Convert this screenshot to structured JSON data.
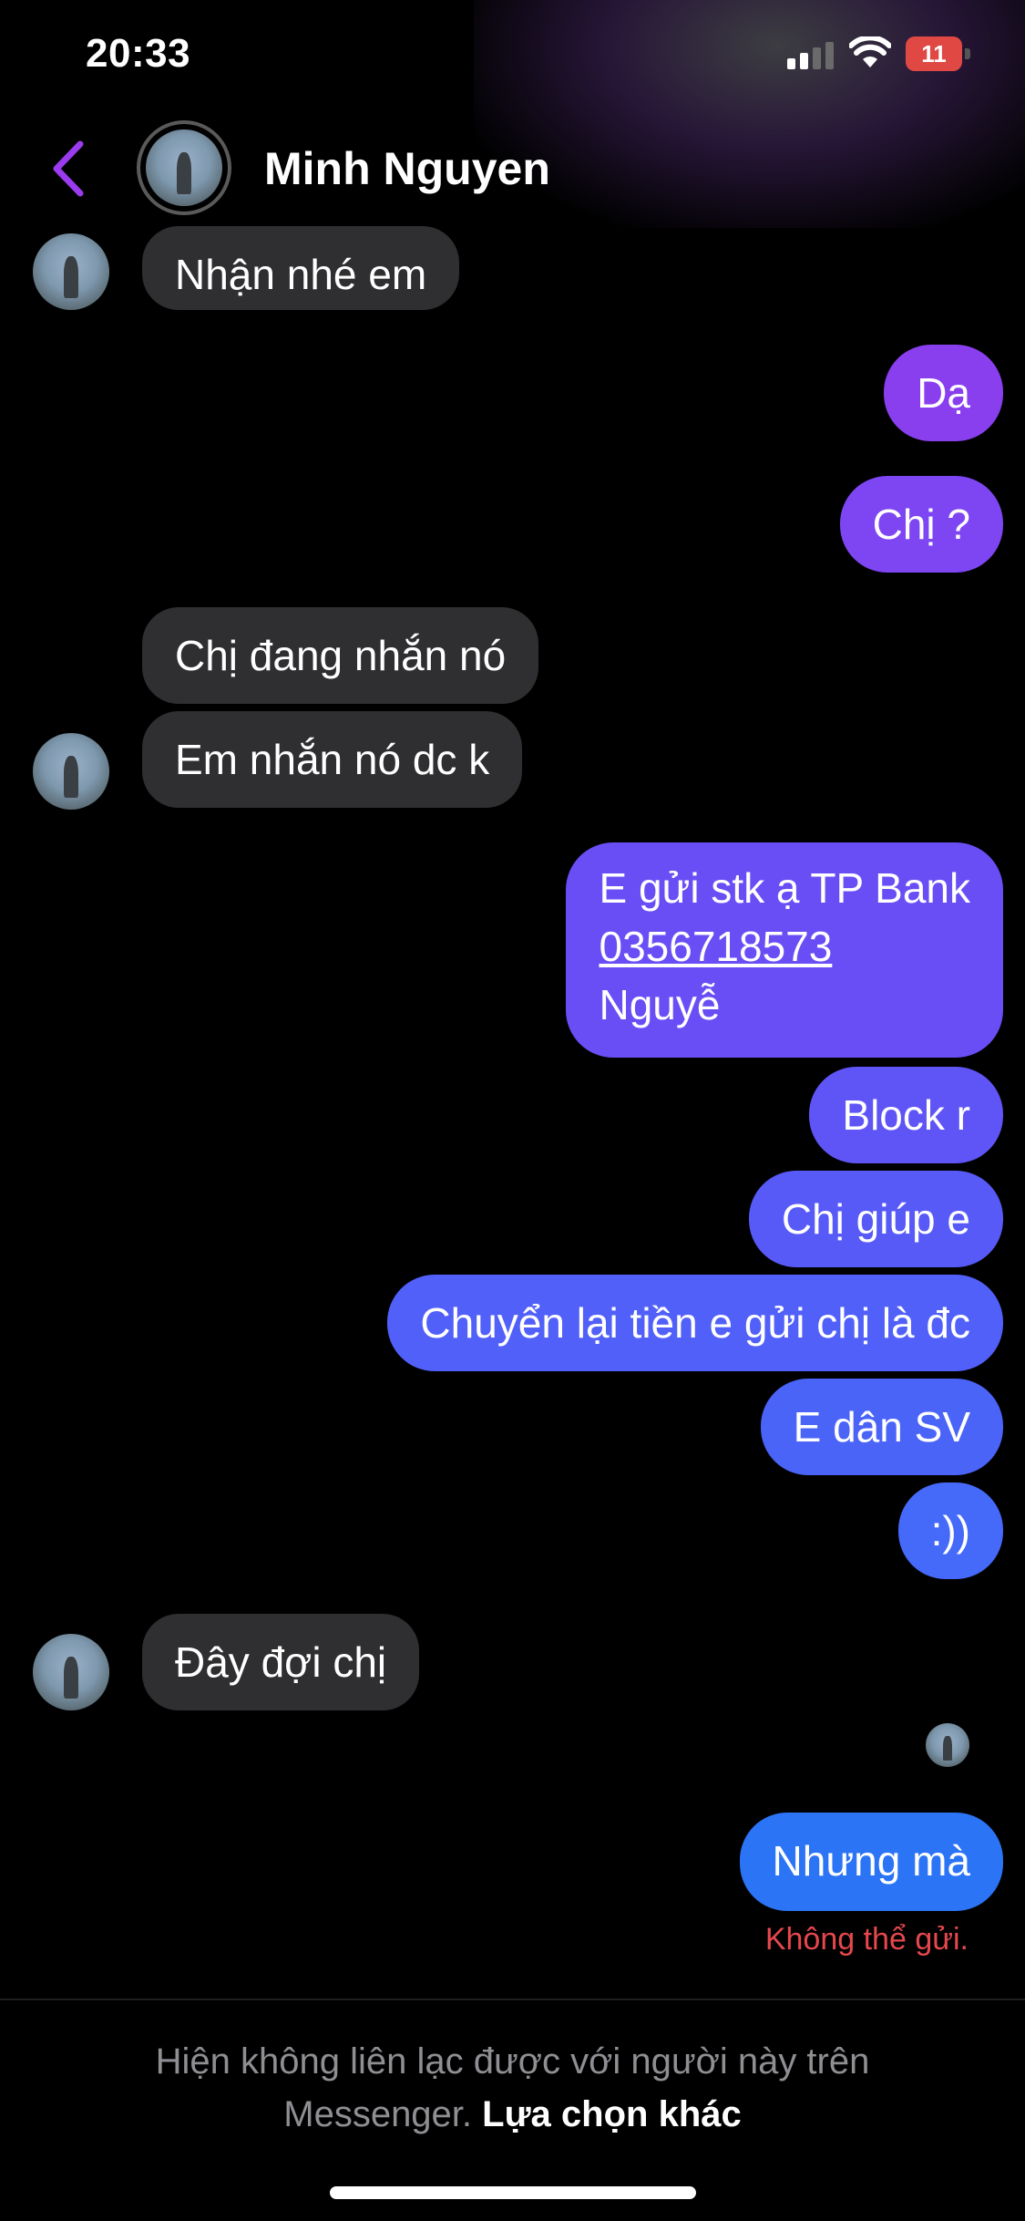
{
  "status_bar": {
    "time": "20:33",
    "battery": "11",
    "battery_color": "#e04844"
  },
  "header": {
    "contact_name": "Minh Nguyen",
    "back_icon": "chevron-left-icon",
    "accent": "#9b3bef"
  },
  "messages": [
    {
      "from": "them",
      "text": "Nhận nhé em"
    },
    {
      "from": "me",
      "text": "Dạ",
      "color": "#8a3fef"
    },
    {
      "from": "me",
      "text": "Chị ?",
      "color": "#7e46f2"
    },
    {
      "from": "them",
      "text": "Chị đang nhắn nó"
    },
    {
      "from": "them",
      "text": "Em nhắn nó dc k"
    },
    {
      "from": "me",
      "line1": "E gửi stk ạ TP Bank",
      "account": "0356718573",
      "line3": "Nguyễ",
      "color": "#6a4ef5"
    },
    {
      "from": "me",
      "text": "Block r",
      "color": "#5f55f6"
    },
    {
      "from": "me",
      "text": "Chị giúp e",
      "color": "#575af7"
    },
    {
      "from": "me",
      "text": "Chuyển lại tiền e gửi chị là đc",
      "color": "#5160f8"
    },
    {
      "from": "me",
      "text": "E dân SV",
      "color": "#4b64f8"
    },
    {
      "from": "me",
      "text": ":))",
      "color": "#456af9"
    },
    {
      "from": "them",
      "text": "Đây đợi chị"
    },
    {
      "from": "me",
      "text": "Nhưng mà",
      "color": "#2b74f6"
    }
  ],
  "send_error": "Không thể gửi.",
  "footer": {
    "notice": "Hiện không liên lạc được với người này trên",
    "notice_2": "Messenger.",
    "link": "Lựa chọn khác"
  }
}
